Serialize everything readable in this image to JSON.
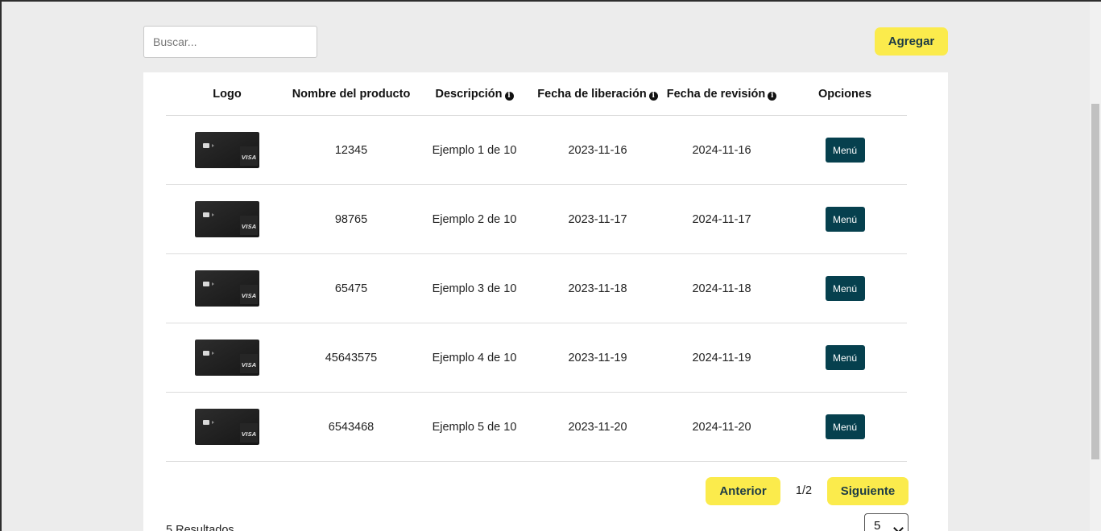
{
  "search": {
    "placeholder": "Buscar..."
  },
  "toolbar": {
    "add_label": "Agregar"
  },
  "table": {
    "headers": {
      "logo": "Logo",
      "name": "Nombre del producto",
      "description": "Descripción",
      "release_date": "Fecha de liberación",
      "review_date": "Fecha de revisión",
      "options": "Opciones"
    },
    "info_icon_glyph": "i",
    "card_brand_text": "VISA",
    "rows": [
      {
        "name": "12345",
        "description": "Ejemplo 1 de 10",
        "release_date": "2023-11-16",
        "review_date": "2024-11-16",
        "menu_label": "Menú"
      },
      {
        "name": "98765",
        "description": "Ejemplo 2 de 10",
        "release_date": "2023-11-17",
        "review_date": "2024-11-17",
        "menu_label": "Menú"
      },
      {
        "name": "65475",
        "description": "Ejemplo 3 de 10",
        "release_date": "2023-11-18",
        "review_date": "2024-11-18",
        "menu_label": "Menú"
      },
      {
        "name": "45643575",
        "description": "Ejemplo 4 de 10",
        "release_date": "2023-11-19",
        "review_date": "2024-11-19",
        "menu_label": "Menú"
      },
      {
        "name": "6543468",
        "description": "Ejemplo 5 de 10",
        "release_date": "2023-11-20",
        "review_date": "2024-11-20",
        "menu_label": "Menú"
      }
    ]
  },
  "pagination": {
    "prev_label": "Anterior",
    "next_label": "Siguiente",
    "page_indicator": "1/2",
    "results_label": "5 Resultados",
    "page_size": "5"
  },
  "colors": {
    "accent_yellow": "#fbeb4c",
    "menu_button": "#06404e",
    "page_background": "#ececec"
  },
  "icons": {
    "info": "info-circle-icon",
    "select_arrow": "chevron-down-icon",
    "card": "credit-card-icon"
  }
}
